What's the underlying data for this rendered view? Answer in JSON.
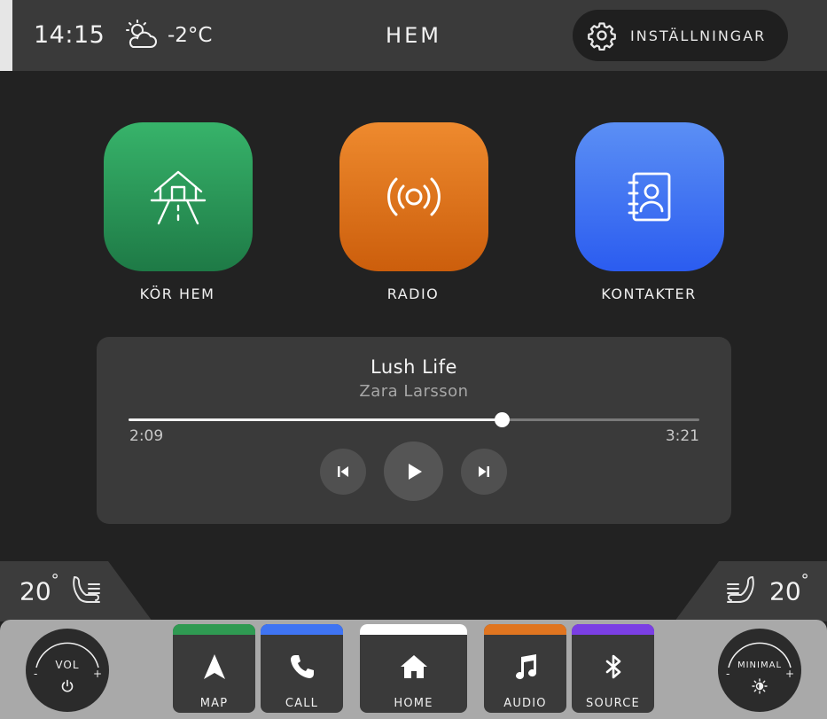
{
  "status_bar": {
    "time": "14:15",
    "weather_icon": "partly-cloudy-icon",
    "temperature": "-2°C",
    "title": "HEM",
    "settings_label": "INSTÄLLNINGAR",
    "settings_icon": "gear-icon"
  },
  "apps": [
    {
      "label": "KÖR HEM",
      "icon": "drive-home-icon",
      "color": "#2e9a5a"
    },
    {
      "label": "RADIO",
      "icon": "radio-broadcast-icon",
      "color": "#e07520"
    },
    {
      "label": "KONTAKTER",
      "icon": "contacts-book-icon",
      "color": "#3f74f3"
    }
  ],
  "player": {
    "song": "Lush Life",
    "artist": "Zara Larsson",
    "elapsed": "2:09",
    "total": "3:21",
    "progress": 0.653,
    "controls": [
      "previous-icon",
      "play-icon",
      "next-icon"
    ]
  },
  "climate": {
    "left_temp": "20",
    "right_temp": "20",
    "degree_symbol": "°",
    "seat_icon": "seat-heat-icon"
  },
  "dock": {
    "volume_knob": {
      "label": "VOL",
      "minus": "-",
      "plus": "+",
      "icon": "power-icon"
    },
    "brightness_knob": {
      "label": "MINIMAL",
      "minus": "-",
      "plus": "+",
      "icon": "brightness-icon"
    },
    "buttons": [
      {
        "label": "MAP",
        "icon": "navigation-arrow-icon",
        "accent": "#2f9a52"
      },
      {
        "label": "CALL",
        "icon": "phone-icon",
        "accent": "#3f74f3"
      },
      {
        "label": "HOME",
        "icon": "home-icon",
        "accent": "#ffffff"
      },
      {
        "label": "AUDIO",
        "icon": "music-note-icon",
        "accent": "#e07520"
      },
      {
        "label": "SOURCE",
        "icon": "bluetooth-icon",
        "accent": "#7b3fe4"
      }
    ]
  }
}
